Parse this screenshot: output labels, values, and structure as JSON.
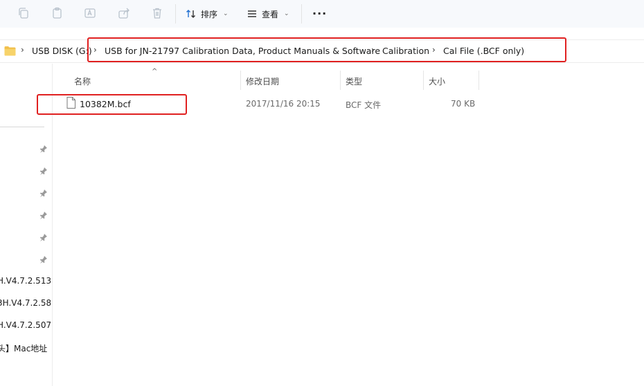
{
  "toolbar": {
    "copy_icon": "copy-icon",
    "paste_icon": "paste-icon",
    "rename_icon": "rename-icon",
    "share_icon": "share-icon",
    "delete_icon": "delete-icon",
    "sort_label": "排序",
    "view_label": "查看",
    "more_label": "···"
  },
  "breadcrumb": {
    "items": [
      "USB DISK (G:)",
      "USB for JN-21797 Calibration Data, Product Manuals & Software",
      "Calibration",
      "Cal File (.BCF only)"
    ],
    "separator": "›"
  },
  "sidebar": {
    "items": [
      "H.V4.7.2.513",
      "3H.V4.7.2.58",
      "H.V4.7.2.507",
      "头】Mac地址"
    ]
  },
  "file_list": {
    "sort_indicator": "^",
    "columns": {
      "name": "名称",
      "modified": "修改日期",
      "type": "类型",
      "size": "大小"
    },
    "rows": [
      {
        "name": "10382M.bcf",
        "modified": "2017/11/16 20:15",
        "type": "BCF 文件",
        "size": "70 KB"
      }
    ]
  },
  "colors": {
    "highlight": "#e02020",
    "toolbar_bg": "#f7f9fc",
    "folder": "#f2c14e"
  }
}
